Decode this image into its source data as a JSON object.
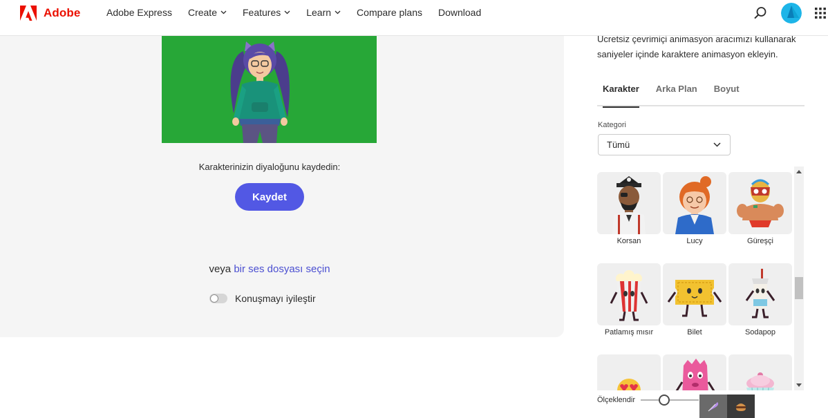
{
  "brand": {
    "name": "Adobe",
    "color": "#eb1000"
  },
  "nav": {
    "items": [
      {
        "label": "Adobe Express",
        "has_menu": false
      },
      {
        "label": "Create",
        "has_menu": true
      },
      {
        "label": "Features",
        "has_menu": true
      },
      {
        "label": "Learn",
        "has_menu": true
      },
      {
        "label": "Compare plans",
        "has_menu": false
      },
      {
        "label": "Download",
        "has_menu": false
      }
    ],
    "icons": [
      "search-icon",
      "avatar",
      "apps-grid-icon"
    ]
  },
  "editor": {
    "stage_background": "#27a737",
    "prompt": "Karakterinizin diyaloğunu kaydedin:",
    "record_button": "Kaydet",
    "alt_prefix": "veya",
    "alt_link": "bir ses dosyası seçin",
    "toggle_label": "Konuşmayı iyileştir",
    "toggle_on": false
  },
  "panel": {
    "description": "Ücretsiz çevrimiçi animasyon aracımızı kullanarak saniyeler içinde karaktere animasyon ekleyin.",
    "tabs": [
      {
        "label": "Karakter",
        "active": true
      },
      {
        "label": "Arka Plan",
        "active": false
      },
      {
        "label": "Boyut",
        "active": false
      }
    ],
    "category_label": "Kategori",
    "category_value": "Tümü",
    "characters": [
      {
        "label": "Korsan"
      },
      {
        "label": "Lucy"
      },
      {
        "label": "Güreşçi"
      },
      {
        "label": "Patlamış mısır"
      },
      {
        "label": "Bilet"
      },
      {
        "label": "Sodapop"
      },
      {
        "label": ""
      },
      {
        "label": ""
      },
      {
        "label": ""
      }
    ],
    "scale_label": "Ölçeklendir",
    "scale_value_fraction": 0.4
  },
  "accent_color": "#5258e4"
}
